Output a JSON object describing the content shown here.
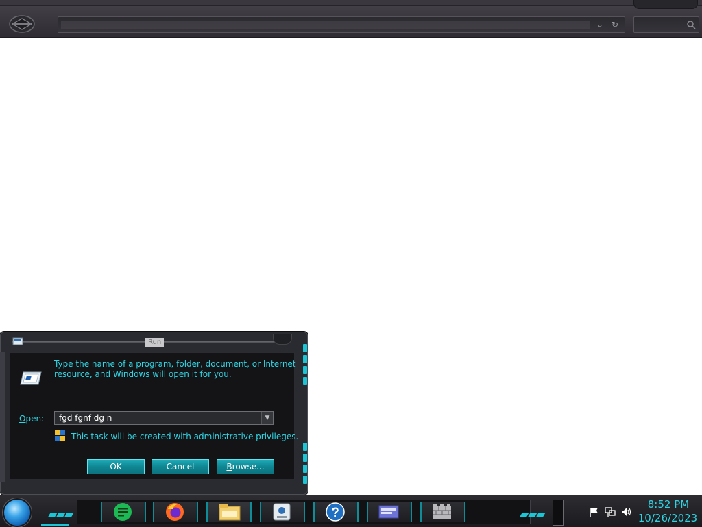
{
  "run_dialog": {
    "title": "Run",
    "description_line1": "Type the name of a program, folder, document, or Internet",
    "description_line2": "resource, and Windows will open it for you.",
    "open_label_accel": "O",
    "open_label_rest": "pen:",
    "open_value": "fgd fgnf dg n",
    "admin_note": "This task will be created with administrative privileges.",
    "ok_label": "OK",
    "cancel_label": "Cancel",
    "browse_label_accel": "B",
    "browse_label_rest": "rowse..."
  },
  "taskbar": {
    "apps": [
      "spotify-icon",
      "firefox-icon",
      "file-explorer-icon",
      "control-panel-icon",
      "help-icon",
      "display-settings-icon",
      "firewall-icon"
    ],
    "clock_time": "8:52 PM",
    "clock_date": "10/26/2023"
  },
  "colors": {
    "accent_cyan": "#18c6d6",
    "text_cyan": "#2fd4e3",
    "button_teal": "#0f8793"
  }
}
